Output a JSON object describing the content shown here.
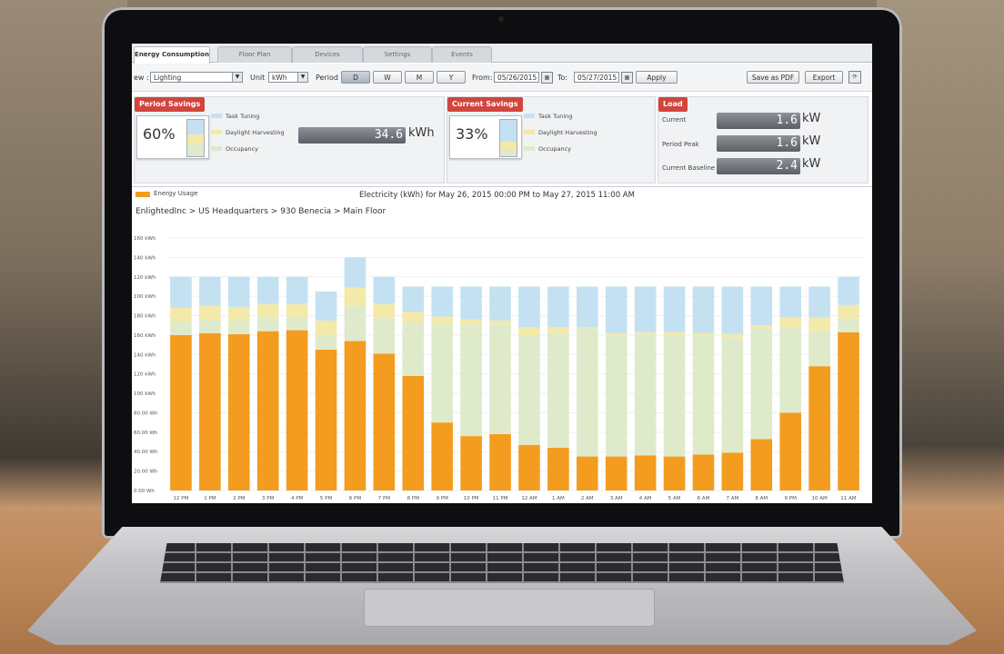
{
  "tabs": [
    "Energy Consumption",
    "Floor Plan",
    "Devices",
    "Settings",
    "Events"
  ],
  "toolbar": {
    "view_label": "ew :",
    "view_value": "Lighting",
    "unit_label": "Unit",
    "unit_value": "kWh",
    "period_label": "Period",
    "period_buttons": [
      "D",
      "W",
      "M",
      "Y"
    ],
    "period_selected": "D",
    "from_label": "From:",
    "from_value": "05/26/2015",
    "to_label": "To:",
    "to_value": "05/27/2015",
    "apply_label": "Apply",
    "save_pdf_label": "Save as PDF",
    "export_label": "Export"
  },
  "period_savings": {
    "title": "Period Savings",
    "percent": "60%",
    "value": "34.6",
    "unit": "kWh",
    "legend": [
      "Task Tuning",
      "Daylight Harvesting",
      "Occupancy"
    ]
  },
  "current_savings": {
    "title": "Current Savings",
    "percent": "33%",
    "legend": [
      "Task Tuning",
      "Daylight Harvesting",
      "Occupancy"
    ]
  },
  "load": {
    "title": "Load",
    "rows": [
      {
        "label": "Current",
        "value": "1.6",
        "unit": "kW"
      },
      {
        "label": "Period Peak",
        "value": "1.6",
        "unit": "kW"
      },
      {
        "label": "Current Baseline",
        "value": "2.4",
        "unit": "kW"
      }
    ]
  },
  "colors": {
    "usage": "#f39c1f",
    "occupancy": "#dfeacb",
    "daylight": "#f3e9a9",
    "task": "#c4e1f2",
    "header_red": "#d2453d"
  },
  "chart": {
    "legend_label": "Energy Usage",
    "title": "Electricity (kWh) for May 26, 2015 00:00 PM to May 27, 2015 11:00 AM",
    "breadcrumb": "EnlightedInc > US Headquarters > 930 Benecia > Main Floor"
  },
  "chart_data": {
    "type": "bar",
    "stacked": true,
    "y_ticks": [
      "0.00 Wh",
      "20.00 Wh",
      "40.00 Wh",
      "60.00 Wh",
      "80.00 Wh",
      "100 kWh",
      "120 kWh",
      "140 kWh",
      "160 kWh",
      "180 kWh",
      "100 kWh",
      "120 kWh",
      "140 kWh",
      "160 kWh"
    ],
    "categories": [
      "12 PM",
      "1 PM",
      "2 PM",
      "3 PM",
      "4 PM",
      "5 PM",
      "6 PM",
      "7 PM",
      "8 PM",
      "9 PM",
      "10 PM",
      "11 PM",
      "12 AM",
      "1 AM",
      "2 AM",
      "3 AM",
      "4 AM",
      "5 AM",
      "6 AM",
      "7 AM",
      "8 AM",
      "9 PM",
      "10 AM",
      "11 AM"
    ],
    "ylim": [
      0,
      260
    ],
    "series": [
      {
        "name": "Energy Usage",
        "values": [
          160,
          162,
          161,
          164,
          165,
          145,
          154,
          141,
          118,
          70,
          56,
          58,
          47,
          44,
          35,
          35,
          36,
          35,
          37,
          39,
          53,
          80,
          128,
          163
        ]
      },
      {
        "name": "Occupancy",
        "values": [
          14,
          14,
          14,
          14,
          14,
          14,
          36,
          37,
          55,
          101,
          115,
          113,
          112,
          118,
          132,
          125,
          125,
          125,
          123,
          118,
          114,
          88,
          36,
          14
        ]
      },
      {
        "name": "Daylight Harvesting",
        "values": [
          14,
          14,
          14,
          14,
          13,
          16,
          19,
          14,
          11,
          8,
          5,
          4,
          9,
          6,
          1,
          2,
          2,
          3,
          2,
          4,
          3,
          10,
          14,
          14
        ]
      },
      {
        "name": "Task Tuning",
        "values": [
          32,
          30,
          31,
          28,
          28,
          30,
          31,
          28,
          26,
          31,
          34,
          35,
          42,
          42,
          42,
          48,
          47,
          47,
          48,
          49,
          40,
          32,
          32,
          29
        ]
      }
    ]
  }
}
